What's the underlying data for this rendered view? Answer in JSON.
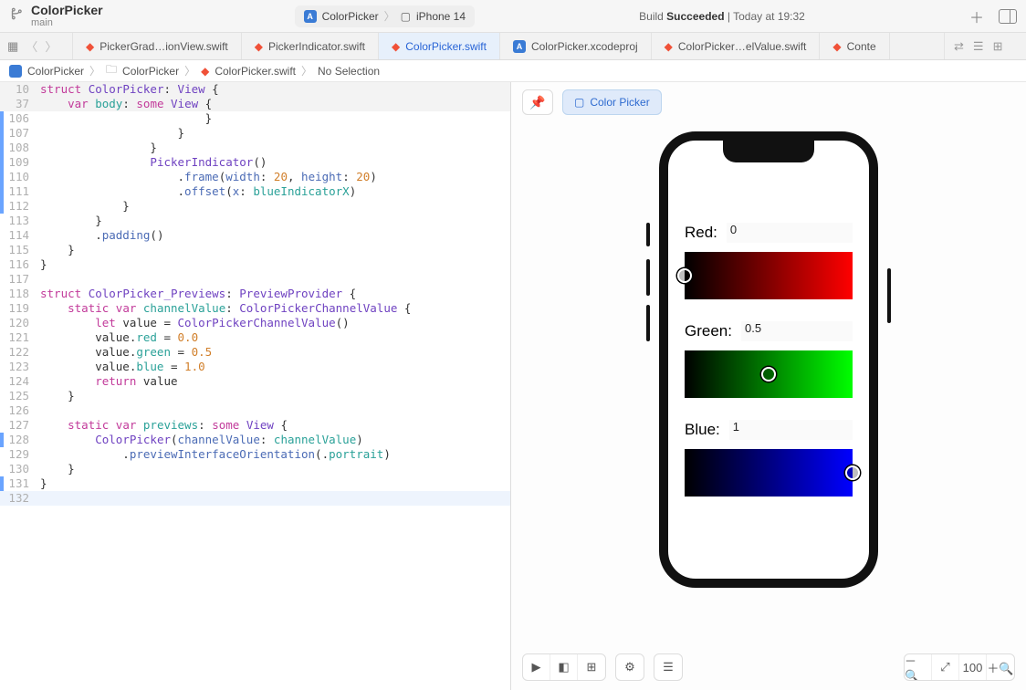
{
  "project": {
    "name": "ColorPicker",
    "branch": "main"
  },
  "scheme": {
    "target": "ColorPicker",
    "device": "iPhone 14"
  },
  "status": {
    "prefix": "Build ",
    "result": "Succeeded",
    "time": " | Today at 19:32"
  },
  "tabs": [
    {
      "label": "PickerGrad…ionView.swift",
      "kind": "swift",
      "active": false
    },
    {
      "label": "PickerIndicator.swift",
      "kind": "swift",
      "active": false
    },
    {
      "label": "ColorPicker.swift",
      "kind": "swift",
      "active": true
    },
    {
      "label": "ColorPicker.xcodeproj",
      "kind": "xcode",
      "active": false
    },
    {
      "label": "ColorPicker…elValue.swift",
      "kind": "swift",
      "active": false
    },
    {
      "label": "Conte",
      "kind": "swift",
      "active": false
    }
  ],
  "breadcrumb": {
    "project": "ColorPicker",
    "group": "ColorPicker",
    "file": "ColorPicker.swift",
    "selection": "No Selection"
  },
  "preview": {
    "chip_label": "Color Picker",
    "channels": {
      "red": {
        "label": "Red:",
        "value": "0",
        "indicator_pct": 0
      },
      "green": {
        "label": "Green:",
        "value": "0.5",
        "indicator_pct": 50
      },
      "blue": {
        "label": "Blue:",
        "value": "1",
        "indicator_pct": 100
      }
    }
  },
  "code": {
    "lines": [
      {
        "n": "10",
        "sticky": true,
        "changed": false,
        "html": "<span class='kw'>struct</span> <span class='ty'>ColorPicker</span>: <span class='ty'>View</span> {"
      },
      {
        "n": "37",
        "sticky": true,
        "changed": false,
        "html": "    <span class='kw'>var</span> <span class='id'>body</span>: <span class='kw'>some</span> <span class='ty'>View</span> {"
      },
      {
        "n": "106",
        "changed": true,
        "html": "                        }"
      },
      {
        "n": "107",
        "changed": true,
        "html": "                    }"
      },
      {
        "n": "108",
        "changed": true,
        "html": "                }"
      },
      {
        "n": "109",
        "changed": true,
        "html": "                <span class='ty'>PickerIndicator</span>()"
      },
      {
        "n": "110",
        "changed": true,
        "html": "                    .<span class='fn'>frame</span>(<span class='fn'>width</span>: <span class='nm'>20</span>, <span class='fn'>height</span>: <span class='nm'>20</span>)"
      },
      {
        "n": "111",
        "changed": true,
        "html": "                    .<span class='fn'>offset</span>(<span class='fn'>x</span>: <span class='id'>blueIndicatorX</span>)"
      },
      {
        "n": "112",
        "changed": true,
        "html": "            }"
      },
      {
        "n": "113",
        "changed": false,
        "html": "        }"
      },
      {
        "n": "114",
        "changed": false,
        "html": "        .<span class='fn'>padding</span>()"
      },
      {
        "n": "115",
        "changed": false,
        "html": "    }"
      },
      {
        "n": "116",
        "changed": false,
        "html": "}"
      },
      {
        "n": "117",
        "changed": false,
        "html": ""
      },
      {
        "n": "118",
        "changed": false,
        "html": "<span class='kw'>struct</span> <span class='ty'>ColorPicker_Previews</span>: <span class='ty'>PreviewProvider</span> {"
      },
      {
        "n": "119",
        "changed": false,
        "html": "    <span class='kw'>static</span> <span class='kw'>var</span> <span class='id'>channelValue</span>: <span class='ty'>ColorPickerChannelValue</span> {"
      },
      {
        "n": "120",
        "changed": false,
        "html": "        <span class='kw'>let</span> value = <span class='ty'>ColorPickerChannelValue</span>()"
      },
      {
        "n": "121",
        "changed": false,
        "html": "        value.<span class='id'>red</span> = <span class='nm'>0.0</span>"
      },
      {
        "n": "122",
        "changed": false,
        "html": "        value.<span class='id'>green</span> = <span class='nm'>0.5</span>"
      },
      {
        "n": "123",
        "changed": false,
        "html": "        value.<span class='id'>blue</span> = <span class='nm'>1.0</span>"
      },
      {
        "n": "124",
        "changed": false,
        "html": "        <span class='kw'>return</span> value"
      },
      {
        "n": "125",
        "changed": false,
        "html": "    }"
      },
      {
        "n": "126",
        "changed": false,
        "html": ""
      },
      {
        "n": "127",
        "changed": false,
        "html": "    <span class='kw'>static</span> <span class='kw'>var</span> <span class='id'>previews</span>: <span class='kw'>some</span> <span class='ty'>View</span> {"
      },
      {
        "n": "128",
        "changed": true,
        "html": "        <span class='ty'>ColorPicker</span>(<span class='fn'>channelValue</span>: <span class='id'>channelValue</span>)"
      },
      {
        "n": "129",
        "changed": false,
        "html": "            .<span class='fn'>previewInterfaceOrientation</span>(.<span class='id'>portrait</span>)"
      },
      {
        "n": "130",
        "changed": false,
        "html": "    }"
      },
      {
        "n": "131",
        "changed": true,
        "html": "}"
      },
      {
        "n": "132",
        "changed": false,
        "cursor": true,
        "html": ""
      }
    ]
  }
}
